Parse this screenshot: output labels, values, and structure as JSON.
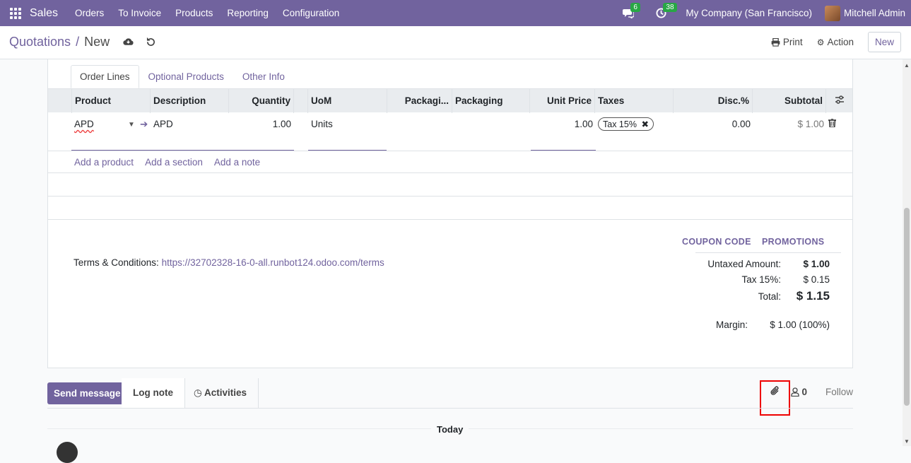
{
  "navbar": {
    "brand": "Sales",
    "menu": [
      "Orders",
      "To Invoice",
      "Products",
      "Reporting",
      "Configuration"
    ],
    "chat_badge": "6",
    "activity_badge": "38",
    "company": "My Company (San Francisco)",
    "user": "Mitchell Admin"
  },
  "control": {
    "parent": "Quotations",
    "current": "New",
    "print_label": "Print",
    "action_label": "Action",
    "new_label": "New"
  },
  "tabs": [
    "Order Lines",
    "Optional Products",
    "Other Info"
  ],
  "table": {
    "headers": [
      "Product",
      "Description",
      "Quantity",
      "UoM",
      "Packagi...",
      "Packaging",
      "Unit Price",
      "Taxes",
      "Disc.%",
      "Subtotal"
    ],
    "row": {
      "product": "APD",
      "description": "APD",
      "quantity": "1.00",
      "uom": "Units",
      "unit_price": "1.00",
      "tax": "Tax 15%",
      "discount": "0.00",
      "subtotal": "$ 1.00"
    },
    "add_links": [
      "Add a product",
      "Add a section",
      "Add a note"
    ]
  },
  "terms": {
    "label": "Terms & Conditions:",
    "link": "https://32702328-16-0-all.runbot124.odoo.com/terms"
  },
  "totals": {
    "coupon_label": "COUPON CODE",
    "promotions_label": "PROMOTIONS",
    "untaxed_label": "Untaxed Amount:",
    "untaxed_value": "$ 1.00",
    "tax_label": "Tax 15%:",
    "tax_value": "$ 0.15",
    "total_label": "Total:",
    "total_value": "$ 1.15",
    "margin_label": "Margin:",
    "margin_value": "$ 1.00 (100%)"
  },
  "chatter": {
    "send_label": "Send message",
    "log_label": "Log note",
    "activities_label": "Activities",
    "followers_count": "0",
    "follow_label": "Follow",
    "today_label": "Today"
  }
}
